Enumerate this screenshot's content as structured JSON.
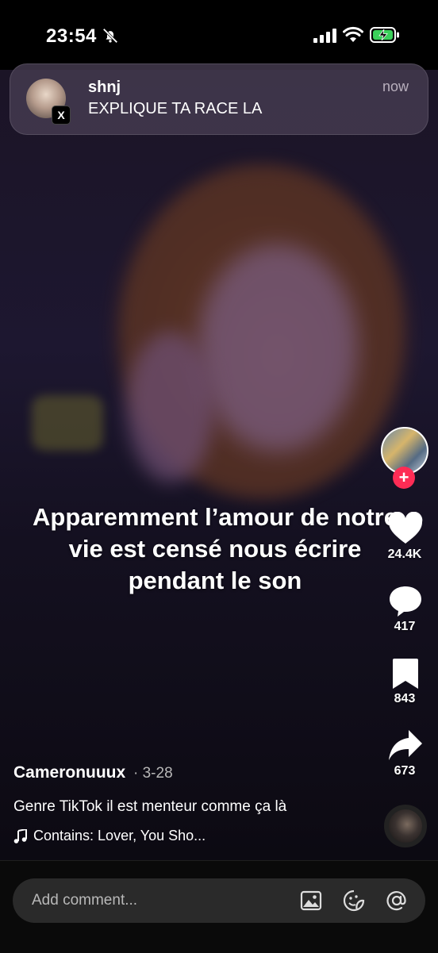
{
  "status_bar": {
    "time": "23:54"
  },
  "notification": {
    "app_icon": "x-logo-icon",
    "badge_glyph": "X",
    "sender": "shnj",
    "message": "EXPLIQUE TA RACE LA",
    "time": "now"
  },
  "video": {
    "caption": "Apparemment  l’amour de notre vie est censé nous écrire pendant le son"
  },
  "actions": {
    "follow_glyph": "+",
    "likes": "24.4K",
    "comments": "417",
    "saves": "843",
    "shares": "673"
  },
  "post": {
    "author": "Cameronuuux",
    "date": "· 3-28",
    "description": "Genre TikTok il est menteur comme ça là",
    "music": "Contains: Lover, You Sho..."
  },
  "comment_bar": {
    "placeholder": "Add comment..."
  },
  "colors": {
    "follow": "#fe2c55",
    "background": "#000000"
  }
}
